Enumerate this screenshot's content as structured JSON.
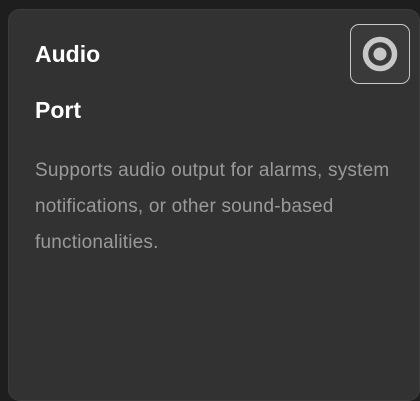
{
  "card": {
    "title_line1": "Audio",
    "title_line2": "Port",
    "description": "Supports audio output for alarms, system notifications, or other sound-based functionalities.",
    "icon": "speaker-target-icon"
  },
  "colors": {
    "background": "#1e1e1e",
    "card": "#323232",
    "title": "#ffffff",
    "description": "#9a9a9a",
    "icon": "#c8c8c8"
  }
}
